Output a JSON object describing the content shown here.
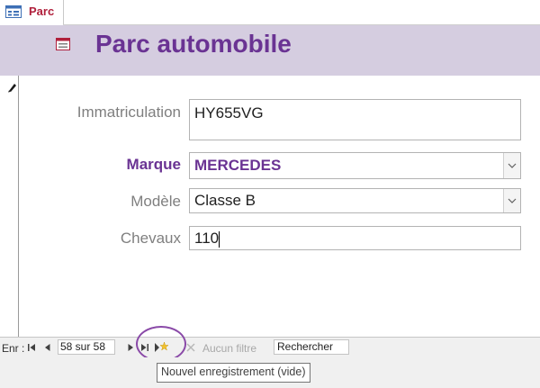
{
  "tab": {
    "label": "Parc",
    "icon": "form-icon"
  },
  "header": {
    "title": "Parc automobile",
    "icon": "form-icon"
  },
  "form": {
    "immatriculation": {
      "label": "Immatriculation",
      "value": "HY655VG"
    },
    "marque": {
      "label": "Marque",
      "value": "MERCEDES"
    },
    "modele": {
      "label": "Modèle",
      "value": "Classe B"
    },
    "chevaux": {
      "label": "Chevaux",
      "value": "110"
    }
  },
  "navigation": {
    "label": "Enr :",
    "record": "58 sur 58",
    "filter": "Aucun filtre",
    "search": "Rechercher"
  },
  "tooltip": {
    "text": "Nouvel enregistrement (vide)"
  },
  "colors": {
    "accent": "#6a3393",
    "header_bg": "#d5cde0",
    "tab_text": "#b0203c"
  }
}
